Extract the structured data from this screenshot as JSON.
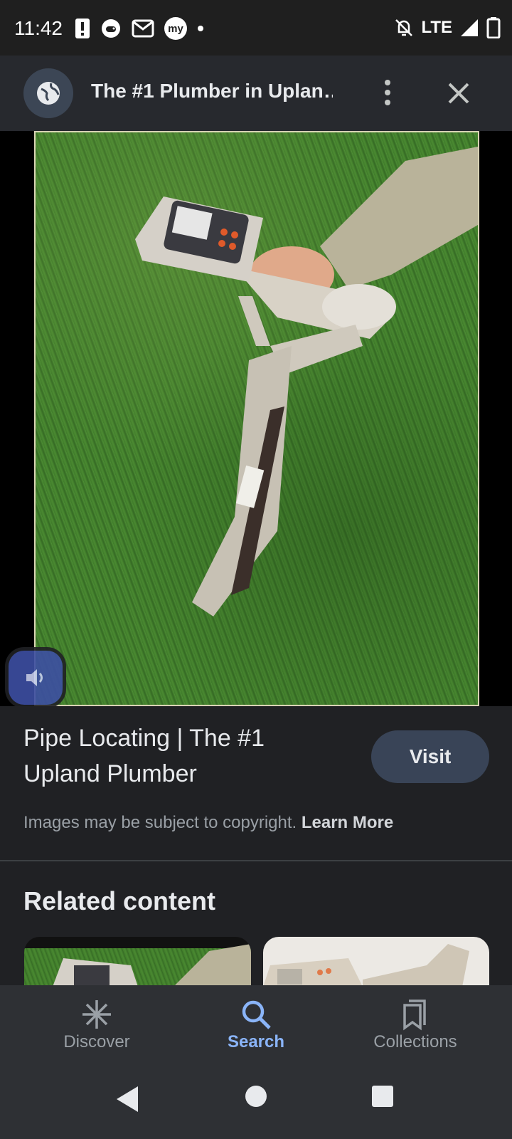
{
  "status_bar": {
    "time": "11:42",
    "network": "LTE",
    "left_icons": [
      "alert-icon",
      "gamepad-icon",
      "mail-icon",
      "mymetro-icon",
      "dot-icon"
    ],
    "right_icons": [
      "bell-off-icon",
      "signal-icon",
      "battery-icon"
    ],
    "badge_text": "my"
  },
  "top_bar": {
    "title": "The #1 Plumber in Uplan…",
    "icons": [
      "globe-icon",
      "more-vert-icon",
      "close-icon"
    ]
  },
  "image_viewer": {
    "controls": [
      "volume-icon",
      "lens-icon"
    ]
  },
  "result": {
    "title": "Pipe Locating | The #1 Upland Plumber",
    "visit_label": "Visit",
    "copyright_text": "Images may be subject to copyright.",
    "learn_more_label": "Learn More"
  },
  "related": {
    "title": "Related content"
  },
  "bottom_nav": {
    "items": [
      {
        "label": "Discover",
        "icon": "asterisk-icon",
        "active": false
      },
      {
        "label": "Search",
        "icon": "search-icon",
        "active": true
      },
      {
        "label": "Collections",
        "icon": "collections-icon",
        "active": false
      }
    ]
  },
  "colors": {
    "accent": "#8ab4f8",
    "background": "#202124",
    "visit_button": "#394457"
  }
}
